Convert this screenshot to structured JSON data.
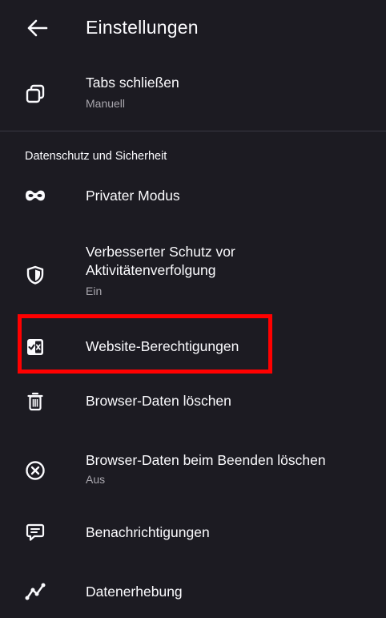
{
  "appbar": {
    "title": "Einstellungen",
    "back_icon": "arrow-left-icon"
  },
  "tabs_close": {
    "title": "Tabs schließen",
    "subtitle": "Manuell",
    "icon": "tabs-icon"
  },
  "privacy_section": {
    "header": "Datenschutz und Sicherheit",
    "items": [
      {
        "title": "Privater Modus",
        "icon": "mask-icon"
      },
      {
        "title_line1": "Verbesserter Schutz vor",
        "title_line2": "Aktivitätenverfolgung",
        "subtitle": "Ein",
        "icon": "shield-icon"
      },
      {
        "title": "Website-Berechtigungen",
        "icon": "permissions-icon"
      },
      {
        "title": "Browser-Daten löschen",
        "icon": "trash-icon"
      },
      {
        "title": "Browser-Daten beim Beenden löschen",
        "subtitle": "Aus",
        "icon": "circle-x-icon"
      },
      {
        "title": "Benachrichtigungen",
        "icon": "message-icon"
      },
      {
        "title": "Datenerhebung",
        "icon": "chart-icon"
      }
    ]
  },
  "colors": {
    "background": "#1c1b22",
    "text": "#fbfbfe",
    "secondary_text": "#a8a6ad",
    "highlight": "#ff0000"
  }
}
